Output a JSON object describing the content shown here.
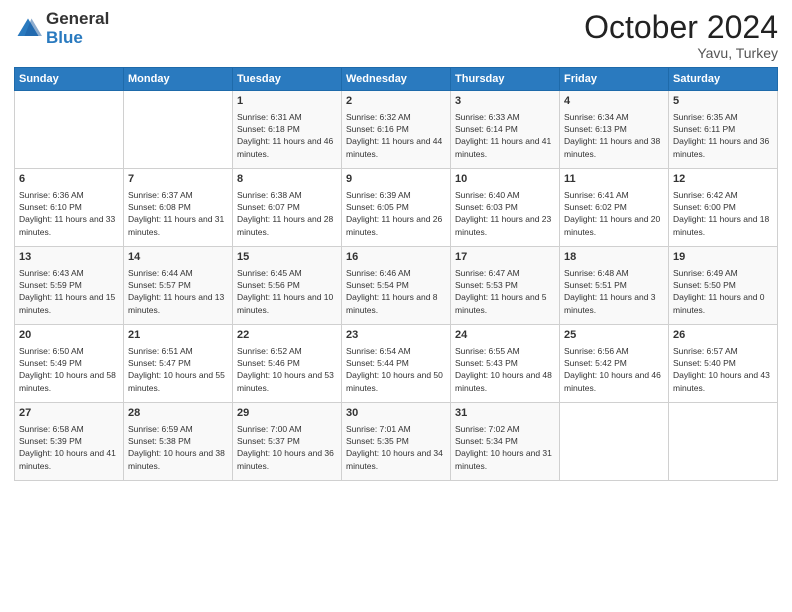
{
  "header": {
    "logo_general": "General",
    "logo_blue": "Blue",
    "month_title": "October 2024",
    "location": "Yavu, Turkey"
  },
  "weekdays": [
    "Sunday",
    "Monday",
    "Tuesday",
    "Wednesday",
    "Thursday",
    "Friday",
    "Saturday"
  ],
  "weeks": [
    [
      {
        "day": "",
        "info": ""
      },
      {
        "day": "",
        "info": ""
      },
      {
        "day": "1",
        "info": "Sunrise: 6:31 AM\nSunset: 6:18 PM\nDaylight: 11 hours and 46 minutes."
      },
      {
        "day": "2",
        "info": "Sunrise: 6:32 AM\nSunset: 6:16 PM\nDaylight: 11 hours and 44 minutes."
      },
      {
        "day": "3",
        "info": "Sunrise: 6:33 AM\nSunset: 6:14 PM\nDaylight: 11 hours and 41 minutes."
      },
      {
        "day": "4",
        "info": "Sunrise: 6:34 AM\nSunset: 6:13 PM\nDaylight: 11 hours and 38 minutes."
      },
      {
        "day": "5",
        "info": "Sunrise: 6:35 AM\nSunset: 6:11 PM\nDaylight: 11 hours and 36 minutes."
      }
    ],
    [
      {
        "day": "6",
        "info": "Sunrise: 6:36 AM\nSunset: 6:10 PM\nDaylight: 11 hours and 33 minutes."
      },
      {
        "day": "7",
        "info": "Sunrise: 6:37 AM\nSunset: 6:08 PM\nDaylight: 11 hours and 31 minutes."
      },
      {
        "day": "8",
        "info": "Sunrise: 6:38 AM\nSunset: 6:07 PM\nDaylight: 11 hours and 28 minutes."
      },
      {
        "day": "9",
        "info": "Sunrise: 6:39 AM\nSunset: 6:05 PM\nDaylight: 11 hours and 26 minutes."
      },
      {
        "day": "10",
        "info": "Sunrise: 6:40 AM\nSunset: 6:03 PM\nDaylight: 11 hours and 23 minutes."
      },
      {
        "day": "11",
        "info": "Sunrise: 6:41 AM\nSunset: 6:02 PM\nDaylight: 11 hours and 20 minutes."
      },
      {
        "day": "12",
        "info": "Sunrise: 6:42 AM\nSunset: 6:00 PM\nDaylight: 11 hours and 18 minutes."
      }
    ],
    [
      {
        "day": "13",
        "info": "Sunrise: 6:43 AM\nSunset: 5:59 PM\nDaylight: 11 hours and 15 minutes."
      },
      {
        "day": "14",
        "info": "Sunrise: 6:44 AM\nSunset: 5:57 PM\nDaylight: 11 hours and 13 minutes."
      },
      {
        "day": "15",
        "info": "Sunrise: 6:45 AM\nSunset: 5:56 PM\nDaylight: 11 hours and 10 minutes."
      },
      {
        "day": "16",
        "info": "Sunrise: 6:46 AM\nSunset: 5:54 PM\nDaylight: 11 hours and 8 minutes."
      },
      {
        "day": "17",
        "info": "Sunrise: 6:47 AM\nSunset: 5:53 PM\nDaylight: 11 hours and 5 minutes."
      },
      {
        "day": "18",
        "info": "Sunrise: 6:48 AM\nSunset: 5:51 PM\nDaylight: 11 hours and 3 minutes."
      },
      {
        "day": "19",
        "info": "Sunrise: 6:49 AM\nSunset: 5:50 PM\nDaylight: 11 hours and 0 minutes."
      }
    ],
    [
      {
        "day": "20",
        "info": "Sunrise: 6:50 AM\nSunset: 5:49 PM\nDaylight: 10 hours and 58 minutes."
      },
      {
        "day": "21",
        "info": "Sunrise: 6:51 AM\nSunset: 5:47 PM\nDaylight: 10 hours and 55 minutes."
      },
      {
        "day": "22",
        "info": "Sunrise: 6:52 AM\nSunset: 5:46 PM\nDaylight: 10 hours and 53 minutes."
      },
      {
        "day": "23",
        "info": "Sunrise: 6:54 AM\nSunset: 5:44 PM\nDaylight: 10 hours and 50 minutes."
      },
      {
        "day": "24",
        "info": "Sunrise: 6:55 AM\nSunset: 5:43 PM\nDaylight: 10 hours and 48 minutes."
      },
      {
        "day": "25",
        "info": "Sunrise: 6:56 AM\nSunset: 5:42 PM\nDaylight: 10 hours and 46 minutes."
      },
      {
        "day": "26",
        "info": "Sunrise: 6:57 AM\nSunset: 5:40 PM\nDaylight: 10 hours and 43 minutes."
      }
    ],
    [
      {
        "day": "27",
        "info": "Sunrise: 6:58 AM\nSunset: 5:39 PM\nDaylight: 10 hours and 41 minutes."
      },
      {
        "day": "28",
        "info": "Sunrise: 6:59 AM\nSunset: 5:38 PM\nDaylight: 10 hours and 38 minutes."
      },
      {
        "day": "29",
        "info": "Sunrise: 7:00 AM\nSunset: 5:37 PM\nDaylight: 10 hours and 36 minutes."
      },
      {
        "day": "30",
        "info": "Sunrise: 7:01 AM\nSunset: 5:35 PM\nDaylight: 10 hours and 34 minutes."
      },
      {
        "day": "31",
        "info": "Sunrise: 7:02 AM\nSunset: 5:34 PM\nDaylight: 10 hours and 31 minutes."
      },
      {
        "day": "",
        "info": ""
      },
      {
        "day": "",
        "info": ""
      }
    ]
  ]
}
